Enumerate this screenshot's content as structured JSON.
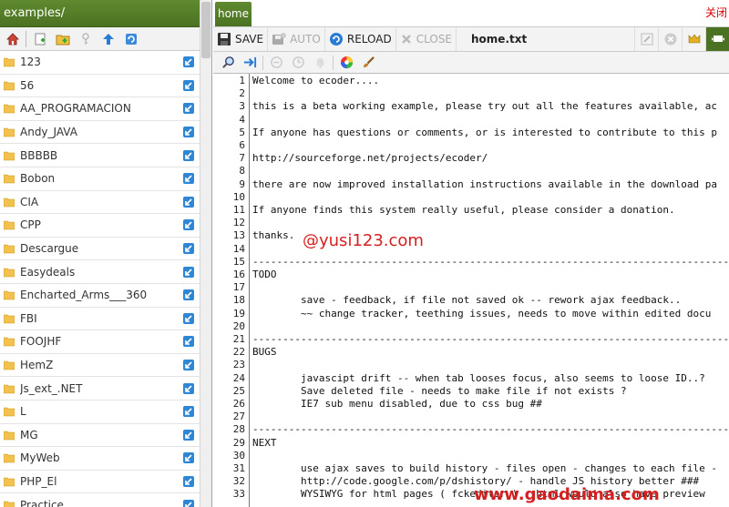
{
  "browser": {
    "title": "examples/",
    "items": [
      {
        "name": "123"
      },
      {
        "name": "56"
      },
      {
        "name": "AA_PROGRAMACION"
      },
      {
        "name": "Andy_JAVA"
      },
      {
        "name": "BBBBB"
      },
      {
        "name": "Bobon"
      },
      {
        "name": "CIA"
      },
      {
        "name": "CPP"
      },
      {
        "name": "Descargue"
      },
      {
        "name": "Easydeals"
      },
      {
        "name": "Encharted_Arms___360"
      },
      {
        "name": "FBI"
      },
      {
        "name": "FOOJHF"
      },
      {
        "name": "HemZ"
      },
      {
        "name": "Js_ext_.NET"
      },
      {
        "name": "L"
      },
      {
        "name": "MG"
      },
      {
        "name": "MyWeb"
      },
      {
        "name": "PHP_El"
      },
      {
        "name": "Practice"
      }
    ]
  },
  "tabs": {
    "home": "home",
    "close": "关闭"
  },
  "toolbar": {
    "save": "SAVE",
    "auto": "AUTO",
    "reload": "RELOAD",
    "close": "CLOSE",
    "filename": "home.txt"
  },
  "editor": {
    "lines": [
      {
        "n": "1",
        "t": "Welcome to ecoder...."
      },
      {
        "n": "2",
        "t": ""
      },
      {
        "n": "3",
        "t": "this is a beta working example, please try out all the features available, ac"
      },
      {
        "n": "4",
        "t": ""
      },
      {
        "n": "5",
        "t": "If anyone has questions or comments, or is interested to contribute to this p"
      },
      {
        "n": "6",
        "t": ""
      },
      {
        "n": "7",
        "t": "http://sourceforge.net/projects/ecoder/"
      },
      {
        "n": "8",
        "t": ""
      },
      {
        "n": "9",
        "t": "there are now improved installation instructions available in the download pa"
      },
      {
        "n": "10",
        "t": ""
      },
      {
        "n": "11",
        "t": "If anyone finds this system really useful, please consider a donation."
      },
      {
        "n": "12",
        "t": ""
      },
      {
        "n": "13",
        "t": "thanks."
      },
      {
        "n": "14",
        "t": ""
      },
      {
        "n": "15",
        "t": "-------------------------------------------------------------------------------"
      },
      {
        "n": "16",
        "t": "TODO"
      },
      {
        "n": "17",
        "t": ""
      },
      {
        "n": "18",
        "t": "        save - feedback, if file not saved ok -- rework ajax feedback.."
      },
      {
        "n": "19",
        "t": "        ~~ change tracker, teething issues, needs to move within edited docu"
      },
      {
        "n": "20",
        "t": ""
      },
      {
        "n": "21",
        "t": "-------------------------------------------------------------------------------"
      },
      {
        "n": "22",
        "t": "BUGS"
      },
      {
        "n": "23",
        "t": ""
      },
      {
        "n": "24",
        "t": "        javascipt drift -- when tab looses focus, also seems to loose ID..?"
      },
      {
        "n": "25",
        "t": "        Save deleted file - needs to make file if not exists ?"
      },
      {
        "n": "26",
        "t": "        IE7 sub menu disabled, due to css bug ##"
      },
      {
        "n": "27",
        "t": ""
      },
      {
        "n": "28",
        "t": "-------------------------------------------------------------------------------"
      },
      {
        "n": "29",
        "t": "NEXT"
      },
      {
        "n": "30",
        "t": ""
      },
      {
        "n": "31",
        "t": "        use ajax saves to build history - files open - changes to each file -"
      },
      {
        "n": "32",
        "t": "        http://code.google.com/p/dshistory/ - handle JS history better ###"
      },
      {
        "n": "33",
        "t": "        WYSIWYG for html pages ( fckeditor ) - html would also have preview"
      }
    ]
  },
  "watermarks": {
    "top": "@yusi123.com",
    "bottom": "www.gaodaima.com"
  },
  "colors": {
    "accent": "#4b7222",
    "close_link": "#d40000",
    "watermark": "#d42020"
  }
}
